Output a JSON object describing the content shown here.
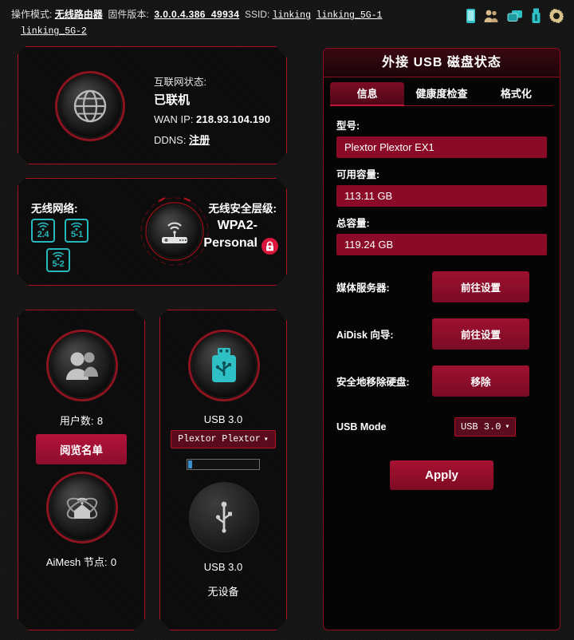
{
  "topbar": {
    "op_mode_label": "操作模式:",
    "op_mode_value": "无线路由器",
    "firmware_label": "固件版本:",
    "firmware_value": "3.0.0.4.386_49934",
    "ssid_label": "SSID:",
    "ssid_1": "linking",
    "ssid_2": "linking_5G-1",
    "ssid_3": "linking_5G-2",
    "icons": [
      "mobile-icon",
      "clients-icon",
      "network-map-icon",
      "usb-icon",
      "settings-gear-icon"
    ]
  },
  "internet": {
    "status_label": "互联网状态:",
    "status_value": "已联机",
    "wan_ip_label": "WAN IP:",
    "wan_ip_value": "218.93.104.190",
    "ddns_label": "DDNS:",
    "ddns_value": "注册",
    "icon": "globe-icon"
  },
  "wireless": {
    "network_label": "无线网络:",
    "security_label": "无线安全层级:",
    "security_value": "WPA2-Personal",
    "bands": [
      "2.4",
      "5-1",
      "5-2"
    ],
    "router_icon": "router-icon",
    "lock_icon": "lock-icon"
  },
  "clients": {
    "count_label": "用户数:",
    "count_value": "8",
    "view_list_button": "阅览名单",
    "icon": "users-icon",
    "aimesh_label": "AiMesh 节点:",
    "aimesh_value": "0",
    "aimesh_icon": "aimesh-node-icon"
  },
  "usb_ports": [
    {
      "title": "USB 3.0",
      "device": "Plextor Plextor",
      "icon": "usb-drive-icon",
      "usage_percent": 5,
      "has_device": true,
      "empty_text": ""
    },
    {
      "title": "USB 3.0",
      "device": "",
      "icon": "usb-empty-icon",
      "usage_percent": 0,
      "has_device": false,
      "empty_text": "无设备"
    }
  ],
  "disk_panel": {
    "title": "外接 USB 磁盘状态",
    "tabs": [
      {
        "label": "信息",
        "active": true
      },
      {
        "label": "健康度检查",
        "active": false
      },
      {
        "label": "格式化",
        "active": false
      }
    ],
    "fields": [
      {
        "label": "型号:",
        "value": "Plextor Plextor EX1"
      },
      {
        "label": "可用容量:",
        "value": "113.11 GB"
      },
      {
        "label": "总容量:",
        "value": "119.24 GB"
      }
    ],
    "actions": [
      {
        "label": "媒体服务器:",
        "button": "前往设置"
      },
      {
        "label": "AiDisk 向导:",
        "button": "前往设置"
      },
      {
        "label": "安全地移除硬盘:",
        "button": "移除"
      }
    ],
    "usb_mode_label": "USB Mode",
    "usb_mode_value": "USB 3.0",
    "apply_label": "Apply"
  },
  "colors": {
    "accent_red": "#b01020",
    "field_red": "#8b0a28",
    "cyan": "#25b9bd",
    "blue_num": "#36a9e1",
    "lock_red": "#d9163c"
  }
}
